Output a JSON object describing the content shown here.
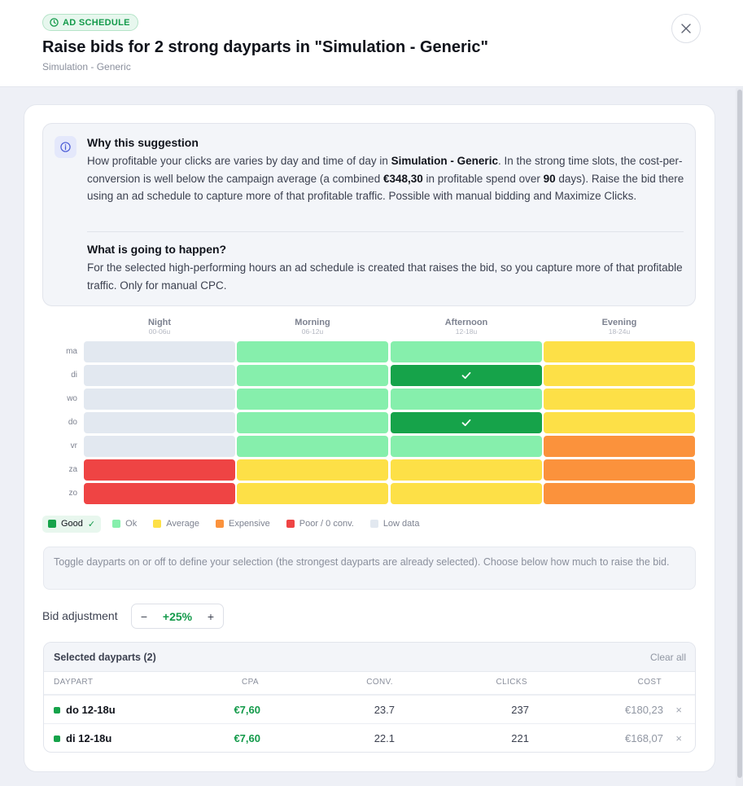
{
  "header": {
    "badge": "AD SCHEDULE",
    "title": "Raise bids for 2 strong dayparts in \"Simulation - Generic\"",
    "subtitle": "Simulation - Generic"
  },
  "why": {
    "title": "Why this suggestion",
    "text_1": "How profitable your clicks are varies by day and time of day in ",
    "campaign": "Simulation - Generic",
    "text_2": ". In the strong time slots, the cost-per-conversion is well below the campaign average (a combined ",
    "amount": "€348,30",
    "text_3": " in profitable spend over ",
    "days": "90",
    "text_4": " days). Raise the bid there using an ad schedule to capture more of that profitable traffic. Possible with manual bidding and Maximize Clicks."
  },
  "happen": {
    "title": "What is going to happen?",
    "text": "For the selected high-performing hours an ad schedule is created that raises the bid, so you capture more of that profitable traffic. Only for manual CPC."
  },
  "heatmap": {
    "columns": [
      {
        "name": "Night",
        "range": "00-06u"
      },
      {
        "name": "Morning",
        "range": "06-12u"
      },
      {
        "name": "Afternoon",
        "range": "12-18u"
      },
      {
        "name": "Evening",
        "range": "18-24u"
      }
    ],
    "rows": [
      {
        "day": "ma",
        "cells": [
          "lowdata",
          "ok",
          "ok",
          "average"
        ]
      },
      {
        "day": "di",
        "cells": [
          "lowdata",
          "ok",
          "good",
          "average"
        ]
      },
      {
        "day": "wo",
        "cells": [
          "lowdata",
          "ok",
          "ok",
          "average"
        ]
      },
      {
        "day": "do",
        "cells": [
          "lowdata",
          "ok",
          "good",
          "average"
        ]
      },
      {
        "day": "vr",
        "cells": [
          "lowdata",
          "ok",
          "ok",
          "expensive"
        ]
      },
      {
        "day": "za",
        "cells": [
          "poor",
          "average",
          "average",
          "expensive"
        ]
      },
      {
        "day": "zo",
        "cells": [
          "poor",
          "average",
          "average",
          "expensive"
        ]
      }
    ],
    "colors": {
      "good": "#16a34a",
      "ok": "#86efac",
      "average": "#fde047",
      "expensive": "#fb923c",
      "poor": "#ef4444",
      "lowdata": "#e2e8f0"
    }
  },
  "legend": [
    {
      "key": "good",
      "label": "Good",
      "check": "✓"
    },
    {
      "key": "ok",
      "label": "Ok"
    },
    {
      "key": "average",
      "label": "Average"
    },
    {
      "key": "expensive",
      "label": "Expensive"
    },
    {
      "key": "poor",
      "label": "Poor / 0 conv."
    },
    {
      "key": "lowdata",
      "label": "Low data"
    }
  ],
  "toggle_note": "Toggle dayparts on or off to define your selection (the strongest dayparts are already selected). Choose below how much to raise the bid.",
  "bid": {
    "label": "Bid adjustment",
    "minus": "−",
    "value": "+25%",
    "plus": "+"
  },
  "selected": {
    "title": "Selected dayparts (2)",
    "clear_all": "Clear all",
    "headers": {
      "daypart": "DAYPART",
      "cpa": "CPA",
      "conv": "CONV.",
      "clicks": "CLICKS",
      "cost": "COST"
    },
    "rows": [
      {
        "daypart": "do 12-18u",
        "cpa": "€7,60",
        "conv": "23.7",
        "clicks": "237",
        "cost": "€180,23",
        "remove": "×"
      },
      {
        "daypart": "di 12-18u",
        "cpa": "€7,60",
        "conv": "22.1",
        "clicks": "221",
        "cost": "€168,07",
        "remove": "×"
      }
    ]
  }
}
